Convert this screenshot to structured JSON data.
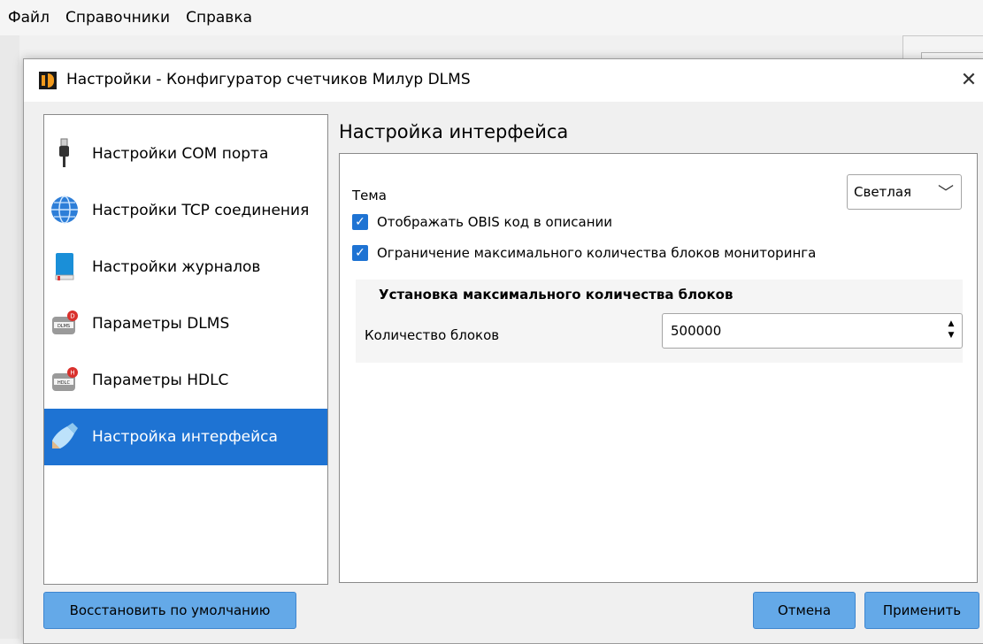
{
  "menubar": {
    "items": [
      "Файл",
      "Справочники",
      "Справка"
    ]
  },
  "dialog": {
    "title": "Настройки - Конфигуратор счетчиков Милур DLMS",
    "close_label": "✕"
  },
  "nav": {
    "items": [
      {
        "label": "Настройки COM порта",
        "icon": "usb-cable-icon"
      },
      {
        "label": "Настройки TCP соединения",
        "icon": "globe-icon"
      },
      {
        "label": "Настройки журналов",
        "icon": "book-icon"
      },
      {
        "label": "Параметры DLMS",
        "icon": "dlms-icon"
      },
      {
        "label": "Параметры HDLC",
        "icon": "hdlc-icon"
      },
      {
        "label": "Настройка интерфейса",
        "icon": "brush-icon",
        "selected": true
      }
    ]
  },
  "main": {
    "section_title": "Настройка интерфейса",
    "theme": {
      "label": "Тема",
      "value": "Светлая"
    },
    "checkboxes": [
      {
        "label": "Отображать OBIS  код в описании",
        "checked": true
      },
      {
        "label": "Ограничение максимального количества блоков мониторинга",
        "checked": true
      }
    ],
    "group": {
      "title": "Установка максимального количества блоков",
      "count_label": "Количество блоков",
      "count_value": "500000"
    }
  },
  "buttons": {
    "restore": "Восстановить по умолчанию",
    "cancel": "Отмена",
    "apply": "Применить"
  },
  "colors": {
    "accent": "#1e73d3",
    "button": "#64a9e8"
  }
}
